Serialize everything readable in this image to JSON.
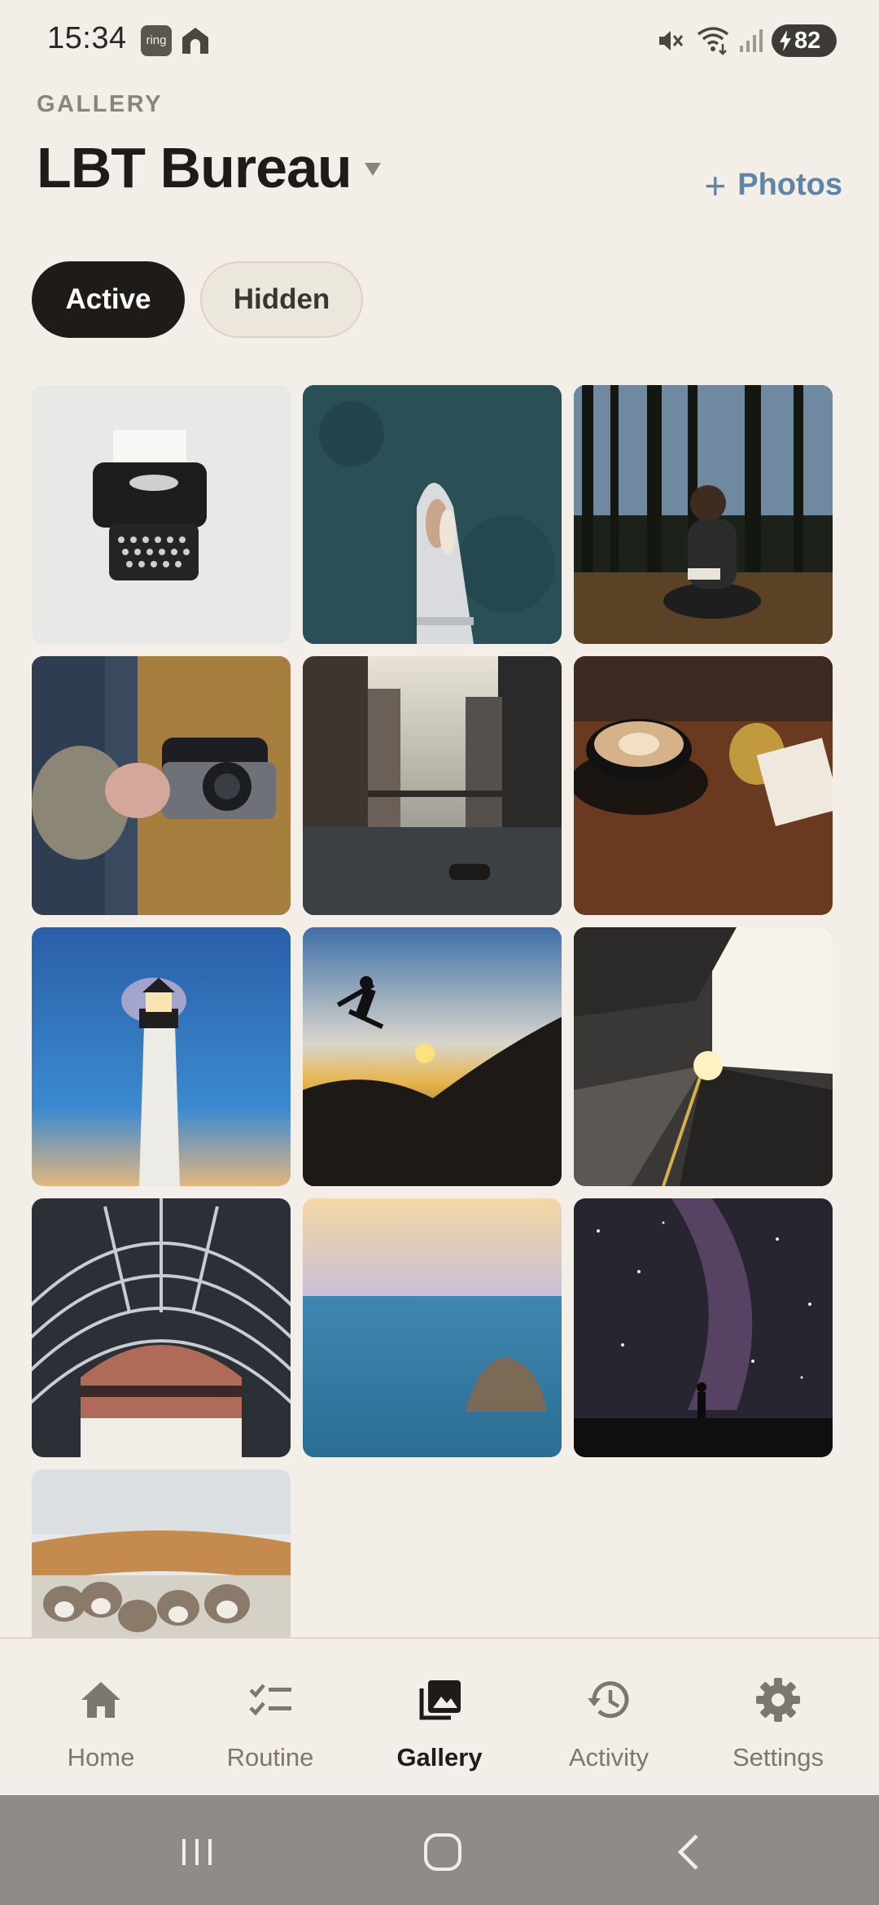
{
  "status_bar": {
    "time": "15:34",
    "ring_label": "ring",
    "battery": "82"
  },
  "header": {
    "caption": "GALLERY",
    "title": "LBT Bureau",
    "add_label": "Photos",
    "add_plus": "+"
  },
  "filters": {
    "active": "Active",
    "hidden": "Hidden"
  },
  "photos": [
    {
      "subject": "typewriter"
    },
    {
      "subject": "couple-on-boat"
    },
    {
      "subject": "woman-in-forest"
    },
    {
      "subject": "hands-with-camera"
    },
    {
      "subject": "city-canal"
    },
    {
      "subject": "latte-and-bell"
    },
    {
      "subject": "lighthouse"
    },
    {
      "subject": "jumping-silhouette"
    },
    {
      "subject": "train-platform"
    },
    {
      "subject": "station-roof"
    },
    {
      "subject": "sea-rock"
    },
    {
      "subject": "milky-way"
    },
    {
      "subject": "kittens-in-basket"
    }
  ],
  "bottom_nav": {
    "items": [
      {
        "label": "Home",
        "icon": "home-icon"
      },
      {
        "label": "Routine",
        "icon": "checklist-icon"
      },
      {
        "label": "Gallery",
        "icon": "gallery-icon",
        "active": true
      },
      {
        "label": "Activity",
        "icon": "history-icon"
      },
      {
        "label": "Settings",
        "icon": "gear-icon"
      }
    ]
  },
  "colors": {
    "background": "#f3efe8",
    "accent": "#5e84aa",
    "primary_dark": "#1f1c18"
  }
}
